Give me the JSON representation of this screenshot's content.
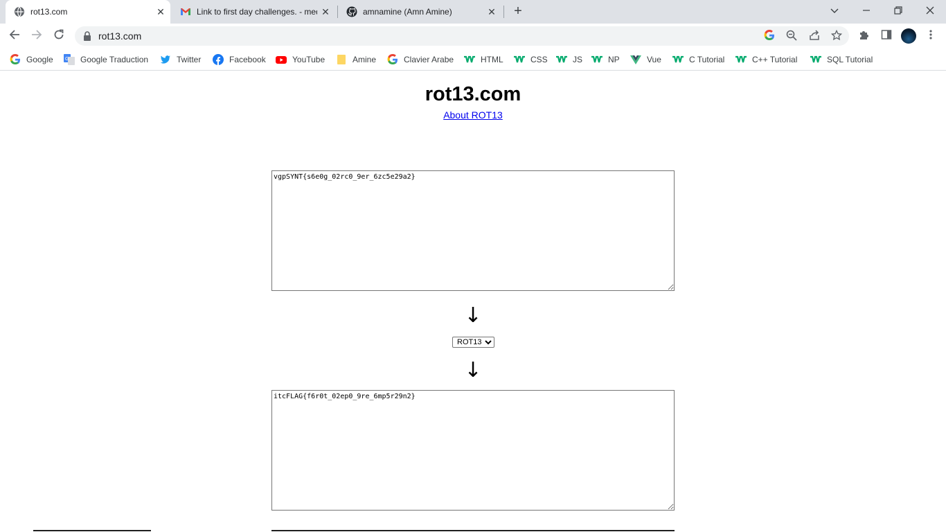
{
  "tabs": [
    {
      "title": "rot13.com",
      "icon": "globe-icon",
      "active": true
    },
    {
      "title": "Link to first day challenges. - med",
      "icon": "gmail-icon",
      "active": false
    },
    {
      "title": "amnamine (Amn Amine)",
      "icon": "github-icon",
      "active": false
    }
  ],
  "address_bar": {
    "url": "rot13.com"
  },
  "bookmarks": [
    {
      "label": "Google",
      "icon": "google-icon"
    },
    {
      "label": "Google Traduction",
      "icon": "google-translate-icon"
    },
    {
      "label": "Twitter",
      "icon": "twitter-icon"
    },
    {
      "label": "Facebook",
      "icon": "facebook-icon"
    },
    {
      "label": "YouTube",
      "icon": "youtube-icon"
    },
    {
      "label": "Amine",
      "icon": "folder-icon"
    },
    {
      "label": "Clavier Arabe",
      "icon": "google-icon"
    },
    {
      "label": "HTML",
      "icon": "w3schools-icon"
    },
    {
      "label": "CSS",
      "icon": "w3schools-icon"
    },
    {
      "label": "JS",
      "icon": "w3schools-icon"
    },
    {
      "label": "NP",
      "icon": "w3schools-icon"
    },
    {
      "label": "Vue",
      "icon": "vue-icon"
    },
    {
      "label": "C Tutorial",
      "icon": "w3schools-icon"
    },
    {
      "label": "C++ Tutorial",
      "icon": "w3schools-icon"
    },
    {
      "label": "SQL Tutorial",
      "icon": "w3schools-icon"
    }
  ],
  "page": {
    "title": "rot13.com",
    "about_link": "About ROT13",
    "input_text": "vgpSYNT{s6e0g_02rc0_9er_6zc5e29a2}",
    "cipher_select": "ROT13",
    "output_text": "itcFLAG{f6r0t_02ep0_9re_6mp5r29n2}",
    "arrow_glyph": "↓"
  },
  "colors": {
    "tabstrip_bg": "#dee1e6",
    "omnibox_bg": "#f1f3f4",
    "link": "#0000ee"
  }
}
